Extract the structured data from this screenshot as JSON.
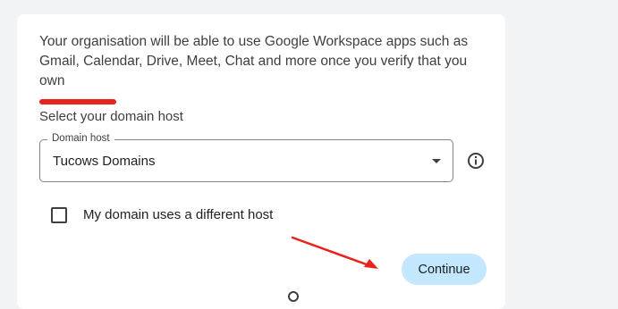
{
  "intro": {
    "text": "Your organisation will be able to use Google Workspace apps such as Gmail, Calendar, Drive, Meet, Chat and more once you verify that you own"
  },
  "domain_host": {
    "section_label": "Select your domain host",
    "field_label": "Domain host",
    "selected_value": "Tucows Domains"
  },
  "different_host": {
    "label": "My domain uses a different host",
    "checked": false
  },
  "actions": {
    "continue_label": "Continue"
  },
  "colors": {
    "page_background": "#f1f3f4",
    "card_background": "#ffffff",
    "primary_button": "#c2e7ff",
    "annotation_arrow": "#e8231e",
    "redaction_mark": "#e8231e"
  },
  "icons": {
    "dropdown": "arrow-drop-down-icon",
    "info": "info-outline-icon"
  }
}
